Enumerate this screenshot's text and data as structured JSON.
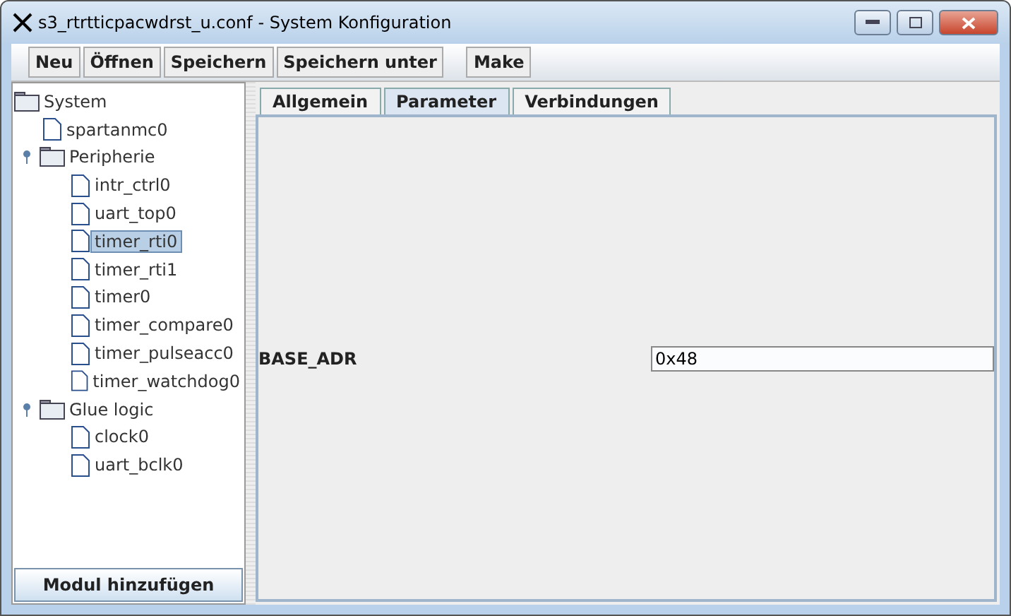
{
  "window": {
    "title": "s3_rtrtticpacwdrst_u.conf - System Konfiguration"
  },
  "toolbar": {
    "groups": [
      [
        "Neu",
        "Öffnen",
        "Speichern",
        "Speichern unter"
      ],
      [
        "Make"
      ]
    ]
  },
  "tree": {
    "label": "System",
    "kind": "folder",
    "selected": false,
    "children": [
      {
        "label": "spartanmc0",
        "kind": "file",
        "selected": false
      },
      {
        "label": "Peripherie",
        "kind": "folder",
        "expanded": true,
        "selected": false,
        "children": [
          {
            "label": "intr_ctrl0",
            "kind": "file",
            "selected": false
          },
          {
            "label": "uart_top0",
            "kind": "file",
            "selected": false
          },
          {
            "label": "timer_rti0",
            "kind": "file",
            "selected": true
          },
          {
            "label": "timer_rti1",
            "kind": "file",
            "selected": false
          },
          {
            "label": "timer0",
            "kind": "file",
            "selected": false
          },
          {
            "label": "timer_compare0",
            "kind": "file",
            "selected": false
          },
          {
            "label": "timer_pulseacc0",
            "kind": "file",
            "selected": false
          },
          {
            "label": "timer_watchdog0",
            "kind": "file",
            "selected": false
          }
        ]
      },
      {
        "label": "Glue logic",
        "kind": "folder",
        "expanded": true,
        "selected": false,
        "children": [
          {
            "label": "clock0",
            "kind": "file",
            "selected": false
          },
          {
            "label": "uart_bclk0",
            "kind": "file",
            "selected": false
          }
        ]
      }
    ]
  },
  "add_button": "Modul hinzufügen",
  "tabs": [
    {
      "label": "Allgemein",
      "selected": false
    },
    {
      "label": "Parameter",
      "selected": true
    },
    {
      "label": "Verbindungen",
      "selected": false
    }
  ],
  "parameters": [
    {
      "name": "BASE_ADR",
      "value": "0x48"
    }
  ]
}
